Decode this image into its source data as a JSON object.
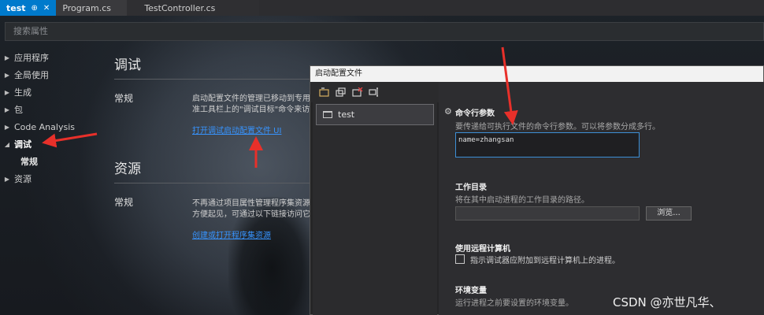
{
  "tabs": [
    {
      "label": "test",
      "active": true
    },
    {
      "label": "Program.cs",
      "active": false
    },
    {
      "label": "TestController.cs",
      "active": false
    }
  ],
  "search": {
    "placeholder": "搜索属性"
  },
  "nav": {
    "items": [
      {
        "label": "应用程序",
        "expanded": false
      },
      {
        "label": "全局使用",
        "expanded": false
      },
      {
        "label": "生成",
        "expanded": false
      },
      {
        "label": "包",
        "expanded": false
      },
      {
        "label": "Code Analysis",
        "expanded": false
      },
      {
        "label": "调试",
        "expanded": true
      },
      {
        "label": "资源",
        "expanded": false
      }
    ],
    "sub_item": "常规"
  },
  "content": {
    "debug": {
      "title": "调试",
      "row_label": "常规",
      "text_line1": "启动配置文件的管理已移动到专用对",
      "text_line2": "准工具栏上的\"调试目标\"命令来访问",
      "link": "打开调试启动配置文件 UI"
    },
    "resources": {
      "title": "资源",
      "row_label": "常规",
      "text_line1": "不再通过项目属性管理程序集资源。",
      "text_line2": "方便起见，可通过以下链接访问它。",
      "link": "创建或打开程序集资源"
    }
  },
  "dialog": {
    "title": "启动配置文件",
    "profiles": [
      "test"
    ],
    "cmd_args": {
      "title": "命令行参数",
      "desc": "要传递给可执行文件的命令行参数。可以将参数分成多行。",
      "value": "name=zhangsan"
    },
    "working_dir": {
      "title": "工作目录",
      "desc": "将在其中启动进程的工作目录的路径。",
      "value": "",
      "browse_label": "浏览..."
    },
    "remote": {
      "title": "使用远程计算机",
      "checkbox_label": "指示调试器应附加到远程计算机上的进程。",
      "checked": false
    },
    "env": {
      "title": "环境变量",
      "desc": "运行进程之前要设置的环境变量。"
    }
  },
  "watermark": "CSDN @亦世凡华、",
  "colors": {
    "accent": "#007acc",
    "link": "#3794ff",
    "arrow": "#e8302a"
  }
}
